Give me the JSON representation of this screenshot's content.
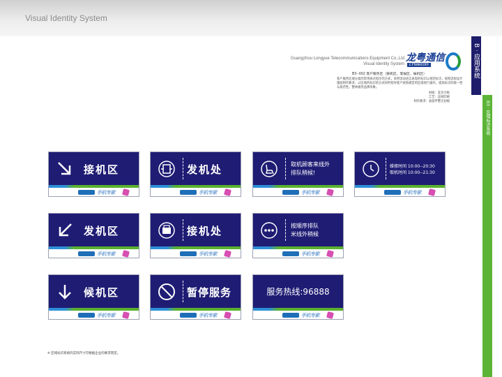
{
  "header": {
    "title": "Visual Identity System",
    "company_en": "Guangzhou Longyue Telecommunications Equipment Co.,Ltd",
    "system_en": "Visual Identity System",
    "logo_cn": "龙粤通信",
    "logo_en": "LYtelecom"
  },
  "tabs": {
    "section": "B · 应用系统",
    "subsection": "B3 · 区域标识系统"
  },
  "description": {
    "title": "B3--002 客户服务区（接机区、等候区、候机区）",
    "body": "客户服务区域分类的常用表达指示的方式，采用流动语言表现的标识以规范标识，按照流程设计版面制作要求，以区域的标识的方式同时指导客户按照规定的区域进行操作，提高标识的统一性与规范性，整体服务品牌形象。",
    "notes": [
      "材质：亚克力板",
      "工艺：丝网印刷",
      "制作要求：表面平整无划痕"
    ]
  },
  "signs": [
    {
      "id": "pickup-area",
      "icon": "arrow-down-right-icon",
      "text": "接机区"
    },
    {
      "id": "send-machine",
      "icon": "phone-box-icon",
      "text": "发机处"
    },
    {
      "id": "queue-outside",
      "icon": "seat-icon",
      "lines": [
        "取机顾客来线外",
        "排队稍候!"
      ]
    },
    {
      "id": "service-hours",
      "icon": "clock-icon",
      "lines": [
        "维修时间 10:00--20:30",
        "取机时间 10:00--21:30"
      ]
    },
    {
      "id": "send-area",
      "icon": "arrow-down-left-icon",
      "text": "发机区"
    },
    {
      "id": "receive-machine",
      "icon": "printer-box-icon",
      "text": "接机处"
    },
    {
      "id": "queue-order",
      "icon": "dots-icon",
      "lines": [
        "按顺序排队",
        "米线外稍候"
      ]
    },
    {
      "id": "waiting-area",
      "icon": "arrow-down-icon",
      "text": "候机区"
    },
    {
      "id": "suspended",
      "icon": "prohibited-icon",
      "text": "暂停服务"
    },
    {
      "id": "hotline",
      "text": "服务热线:96888"
    }
  ],
  "footer": {
    "note": "※ 区域标识系统的实际尺寸可根据企业的要求而定。"
  },
  "colors": {
    "navy": "#1f1c74",
    "green": "#5bb437",
    "blue": "#2e8fd7"
  }
}
